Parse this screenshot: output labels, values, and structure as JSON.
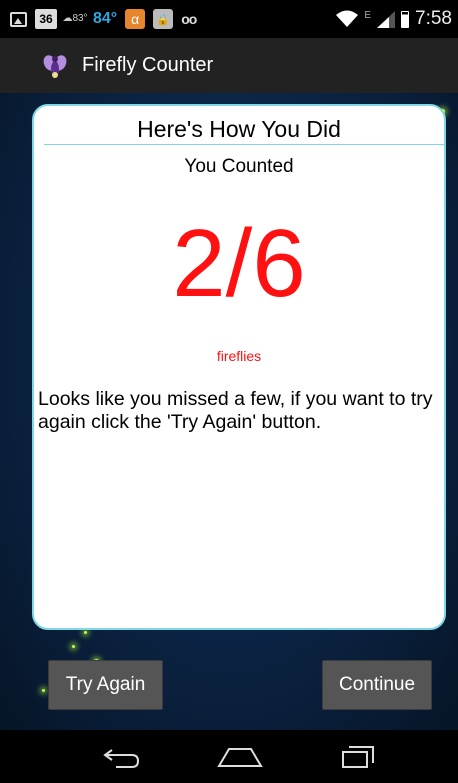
{
  "status_bar": {
    "calendar_day": "36",
    "weather_small": "83°",
    "temperature": "84°",
    "alpha_glyph": "α",
    "network_type": "E",
    "time": "7:58",
    "colors": {
      "temperature": "#2fa7e0",
      "alpha_icon_bg": "#e5862c"
    }
  },
  "action_bar": {
    "app_icon": "firefly-icon",
    "title": "Firefly Counter"
  },
  "dialog": {
    "title": "Here's How You Did",
    "counted_label": "You Counted",
    "count": "2/6",
    "unit": "fireflies",
    "message": "Looks like you missed a few, if you want to try again click the 'Try Again' button.",
    "colors": {
      "count": "#ff1111",
      "border": "#7fd8e6"
    }
  },
  "buttons": {
    "try_again": "Try Again",
    "continue": "Continue"
  },
  "nav_bar": {
    "icons": [
      "back-icon",
      "home-icon",
      "recent-apps-icon"
    ]
  }
}
